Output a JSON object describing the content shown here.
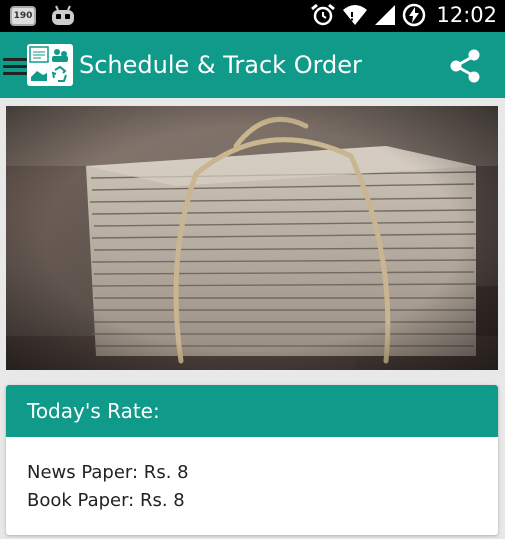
{
  "status_bar": {
    "notification_badge": "190",
    "time": "12:02",
    "icons": [
      "android-robot-icon",
      "alarm-icon",
      "wifi-icon",
      "signal-icon",
      "battery-charging-icon"
    ]
  },
  "app_bar": {
    "title": "Schedule & Track Order",
    "icons": [
      "hamburger-icon",
      "app-logo-icon",
      "share-icon"
    ]
  },
  "hero": {
    "subject": "newspaper-bundle-image"
  },
  "rate_card": {
    "title": "Today's Rate:",
    "lines": [
      "News Paper: Rs. 8",
      "Book Paper: Rs. 8"
    ]
  },
  "colors": {
    "primary": "#109a8a",
    "status_bar": "#000000",
    "background": "#e8e8e8"
  }
}
